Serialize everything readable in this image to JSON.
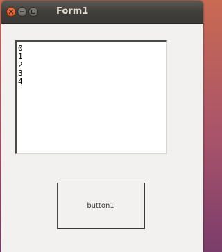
{
  "window": {
    "title": "Form1",
    "controls": {
      "close": "close-icon",
      "minimize": "minimize-icon",
      "maximize": "maximize-icon"
    }
  },
  "listbox": {
    "items": [
      "0",
      "1",
      "2",
      "3",
      "4"
    ]
  },
  "button": {
    "label": "button1"
  },
  "colors": {
    "titlebar": "#3f3e3a",
    "title_text": "#dfdbd2",
    "close_button": "#e05c31",
    "window_bg": "#f2f1f0"
  }
}
